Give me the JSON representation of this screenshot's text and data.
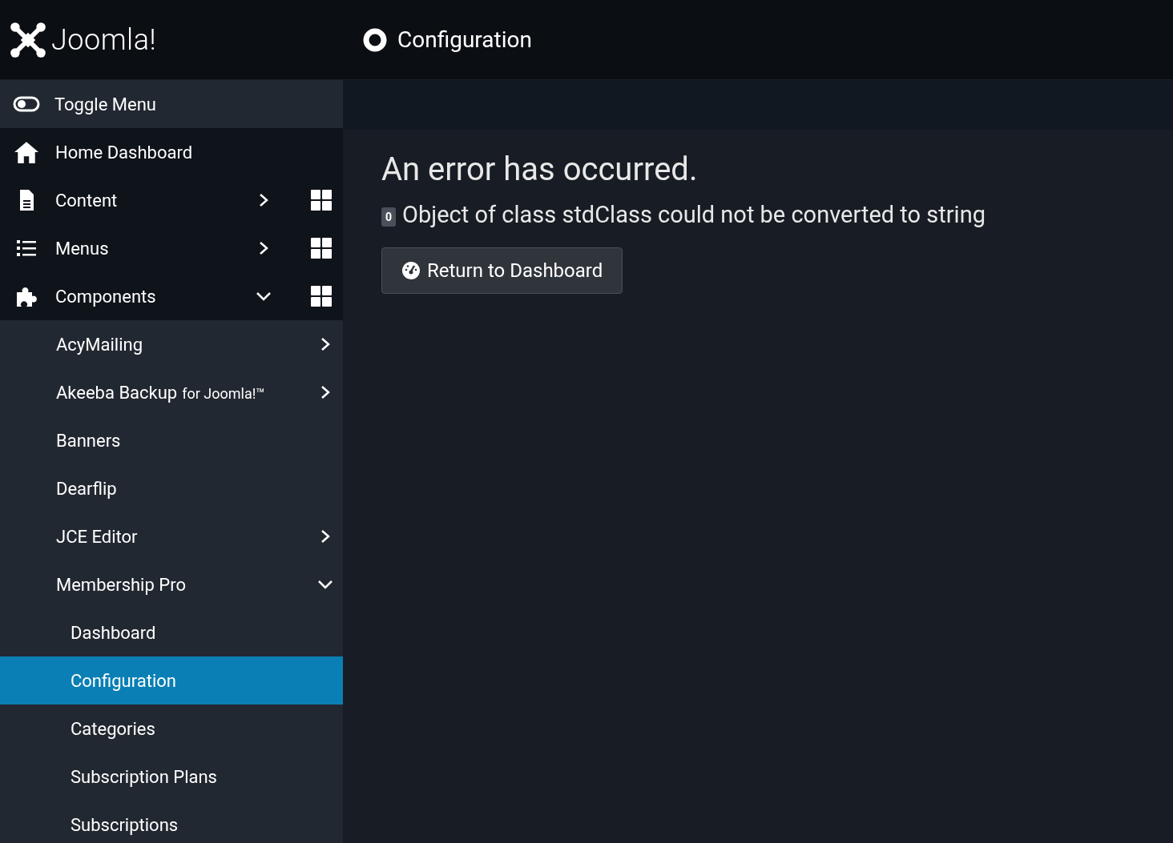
{
  "header": {
    "logo": "Joomla!",
    "page_title": "Configuration"
  },
  "sidebar": {
    "toggle": {
      "label": "Toggle Menu"
    },
    "items": [
      {
        "label": "Home Dashboard",
        "kind": "home",
        "selected": false
      },
      {
        "label": "Content",
        "kind": "document",
        "expanded": false,
        "dashboard": true,
        "selected": false
      },
      {
        "label": "Menus",
        "kind": "list",
        "expanded": false,
        "dashboard": true,
        "selected": false
      },
      {
        "label": "Components",
        "kind": "extension",
        "expanded": true,
        "dashboard": true,
        "selected": false,
        "children": [
          {
            "label": "AcyMailing",
            "expanded": false,
            "selected": false
          },
          {
            "label": "Akeeba Backup",
            "suffix": "for Joomla!™",
            "expanded": false,
            "selected": false
          },
          {
            "label": "Banners",
            "selected": false
          },
          {
            "label": "Dearflip",
            "selected": false
          },
          {
            "label": "JCE Editor",
            "expanded": false,
            "selected": false
          },
          {
            "label": "Membership Pro",
            "expanded": true,
            "selected": false,
            "children": [
              {
                "label": "Dashboard",
                "selected": false
              },
              {
                "label": "Configuration",
                "selected": true
              },
              {
                "label": "Categories",
                "selected": false
              },
              {
                "label": "Subscription Plans",
                "selected": false
              },
              {
                "label": "Subscriptions",
                "selected": false
              }
            ]
          }
        ]
      }
    ]
  },
  "error": {
    "heading": "An error has occurred.",
    "code": "0",
    "message": "Object of class stdClass could not be converted to string",
    "button": "Return to Dashboard"
  }
}
